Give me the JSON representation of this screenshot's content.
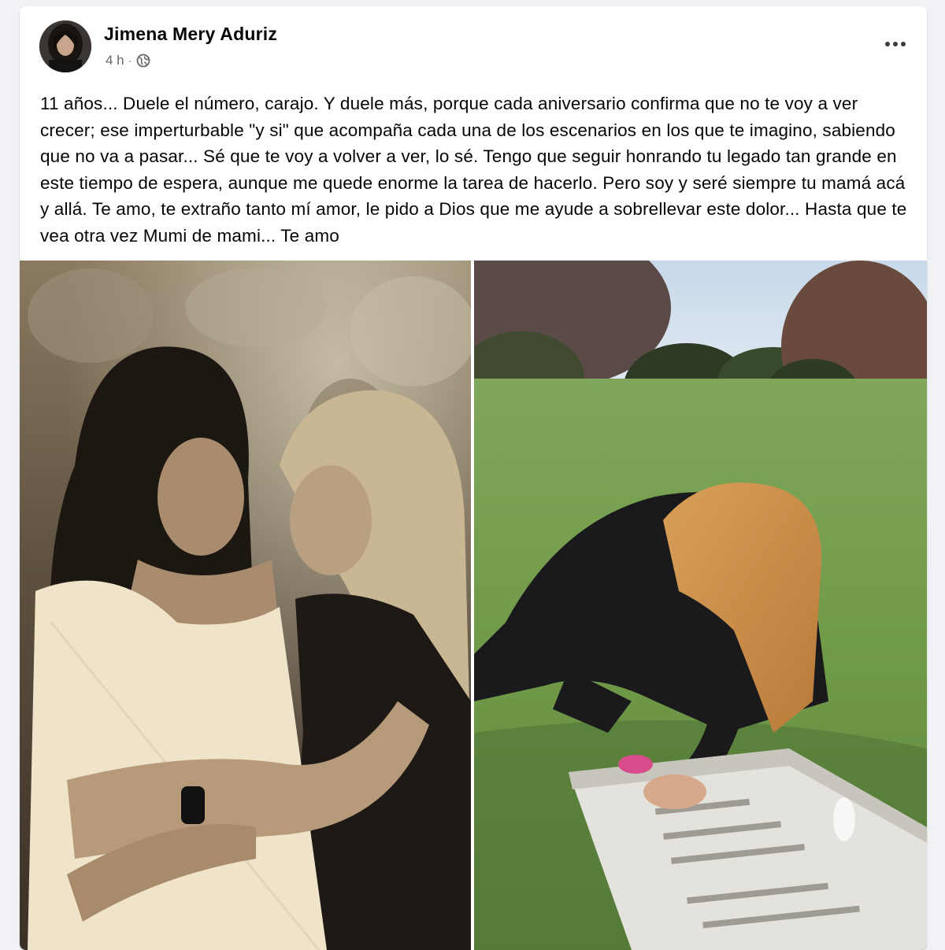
{
  "post": {
    "author": {
      "name": "Jimena Mery Aduriz",
      "avatar_icon": "profile-avatar"
    },
    "timestamp": "4 h",
    "separator": "·",
    "privacy_icon": "globe-icon",
    "more_icon": "more-options-icon",
    "text": "11 años... Duele el número, carajo. Y duele más, porque cada aniversario confirma que no te voy a ver crecer; ese imperturbable \"y si\" que acompaña cada una de los escenarios en los que te imagino, sabiendo que no va a pasar... Sé que te voy a volver a ver, lo sé. Tengo que seguir honrando tu legado tan grande en este tiempo de espera, aunque me quede enorme la tarea de hacerlo. Pero soy y seré siempre tu mamá acá y allá. Te amo, te extraño tanto mí amor, le pido a Dios que me ayude a sobrellevar este dolor... Hasta que te vea otra vez Mumi de mami... Te amo",
    "photos": [
      {
        "id": "photo-1"
      },
      {
        "id": "photo-2"
      }
    ]
  },
  "colors": {
    "background": "#f0f2f5",
    "card": "#ffffff",
    "text_primary": "#050505",
    "text_secondary": "#65676b"
  }
}
